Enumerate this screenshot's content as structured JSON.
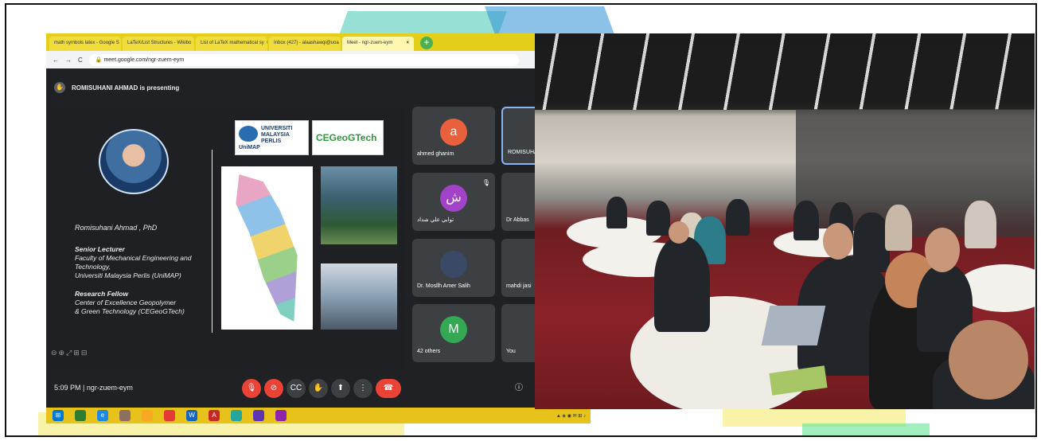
{
  "browser": {
    "tabs": [
      {
        "label": "math symbols latex - Google S",
        "active": false
      },
      {
        "label": "LaTeX/List Structures - Wikibo",
        "active": false
      },
      {
        "label": "List of LaTeX mathematical sy",
        "active": false
      },
      {
        "label": "Inbox (427) - alaashawqi@uoa",
        "active": false
      },
      {
        "label": "Meet - ngr-zuem-eym",
        "active": true
      }
    ],
    "url": "meet.google.com/ngr-zuem-eym"
  },
  "meet": {
    "presenting_text": "ROMISUHANI AHMAD is presenting",
    "slide": {
      "name": "Romisuhani Ahmad , PhD",
      "role1_title": "Senior Lecturer",
      "role1_line1": "Faculty of Mechanical Engineering and",
      "role1_line2": "Technology,",
      "role1_line3": "Universiti Malaysia Perlis (UniMAP)",
      "role2_title": "Research Fellow",
      "role2_line1": "Center of Excellence Geopolymer",
      "role2_line2": "& Green Technology (CEGeoGTech)",
      "logo1_line1": "UNIVERSITI",
      "logo1_line2": "MALAYSIA",
      "logo1_line3": "PERLIS",
      "logo1_brand": "UniMAP",
      "logo2": "CEGeoGTech"
    },
    "participants": [
      {
        "name": "ahmed ghanim",
        "initial": "a",
        "color": "#e8603c"
      },
      {
        "name": "ROMISUHA",
        "initial": "",
        "color": "#5f6368"
      },
      {
        "name": "ثوابي علي شداد",
        "initial": "ش",
        "color": "#a142c8"
      },
      {
        "name": "Dr Abbas",
        "initial": "",
        "color": "#e8603c"
      },
      {
        "name": "Dr. Mosllh Amer Salih",
        "initial": "",
        "color": "#5f6368"
      },
      {
        "name": "mahdi jasi",
        "initial": "",
        "color": "#5f6368"
      },
      {
        "name": "42 others",
        "initial": "M",
        "color": "#34a853"
      },
      {
        "name": "You",
        "initial": "",
        "color": "#5f6368"
      }
    ],
    "time": "5:09 PM",
    "meeting_code": "ngr-zuem-eym"
  },
  "colors": {
    "tab_yellow": "#e3cf1a",
    "end_call": "#ea4335",
    "meet_bg": "#202124"
  },
  "icons": [
    "back-icon",
    "forward-icon",
    "reload-icon",
    "lock-icon",
    "mic-off-icon",
    "camera-off-icon",
    "captions-icon",
    "raise-hand-icon",
    "present-icon",
    "more-options-icon",
    "end-call-icon",
    "info-icon"
  ]
}
